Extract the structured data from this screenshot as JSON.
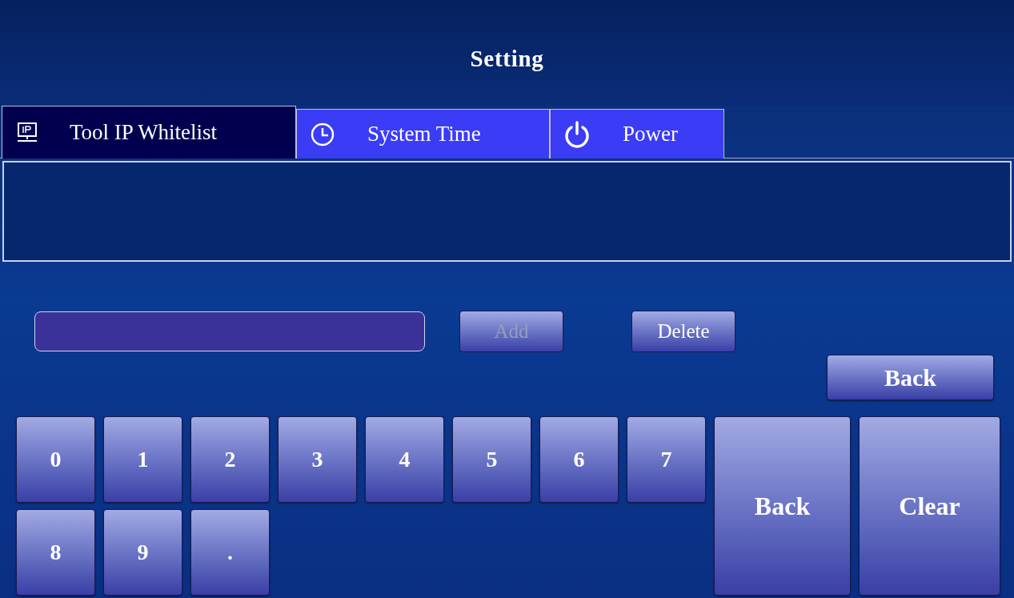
{
  "title": "Setting",
  "tabs": [
    {
      "label": "Tool IP Whitelist",
      "selected": true
    },
    {
      "label": "System Time",
      "selected": false
    },
    {
      "label": "Power",
      "selected": false
    }
  ],
  "ip_actions": [
    {
      "label": "Add",
      "disabled": true
    },
    {
      "label": "Delete",
      "disabled": false
    }
  ],
  "back_button": {
    "label": "Back"
  },
  "keypad": {
    "keys": [
      "0",
      "1",
      "2",
      "3",
      "4",
      "5",
      "6",
      "7",
      "8",
      "9",
      "."
    ],
    "large_keys": [
      "Back",
      "Clear"
    ]
  }
}
